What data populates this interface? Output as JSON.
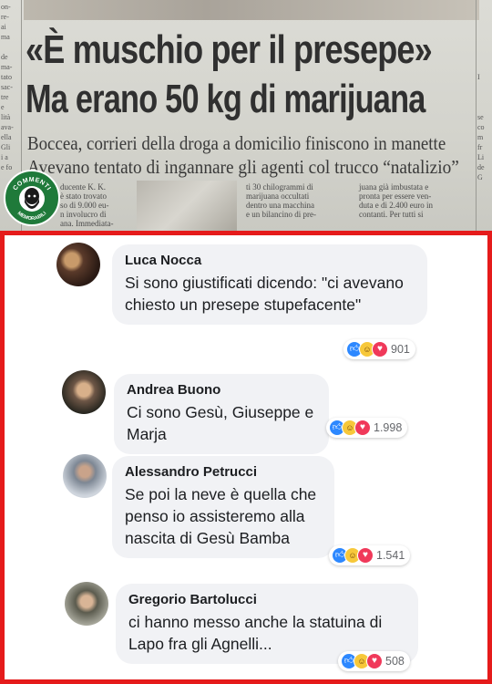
{
  "newspaper": {
    "headline_1": "«È muschio per il presepe»",
    "headline_2": "Ma erano 50 kg di marijuana",
    "subhead_1": "Boccea, corrieri della droga a domicilio finiscono in manette",
    "subhead_2": "Avevano tentato di ingannare gli agenti col trucco “natalizio”",
    "body_col_1": "ducente K. K.\nè stato trovato\nso di 9.000 eu-\nn involucro di\nana. Immediata-",
    "body_col_2": "ti 30 chilogrammi di\nmarijuana occultati\ndentro una macchina\ne un bilancino di pre-",
    "body_col_3": "juana già imbustata e\npronta per essere ven-\nduta e di 2.400 euro in\ncontanti. Per tutti si",
    "left_margin_text": "on-\nre-\nai\nma\n\nde\nma-\ntato\nsac-\ntre\ne\nlità\nava-\nella\nGli\ni a\ne fo",
    "right_margin_text": "\n\n\n\n\n\n\nI\n\n\n\nse\nco\nm\nfr\nLi\nde\nG"
  },
  "logo": {
    "text_top": "COMMENTI",
    "text_bottom": "MEMORABILI"
  },
  "comments": [
    {
      "author": "Luca Nocca",
      "text": "Si sono giustificati dicendo: \"ci avevano chiesto un presepe stupefacente\"",
      "reactions": [
        "like",
        "haha",
        "love"
      ],
      "count": "901"
    },
    {
      "author": "Andrea Buono",
      "text": "Ci sono Gesù, Giuseppe e Marja",
      "reactions": [
        "like",
        "haha",
        "love"
      ],
      "count": "1.998"
    },
    {
      "author": "Alessandro Petrucci",
      "text": "Se poi la neve è quella che penso io assisteremo alla nascita di Gesù Bamba",
      "reactions": [
        "like",
        "haha",
        "love"
      ],
      "count": "1.541"
    },
    {
      "author": "Gregorio Bartolucci",
      "text": "ci hanno messo anche la statuina di Lapo fra gli Agnelli...",
      "reactions": [
        "like",
        "haha",
        "love"
      ],
      "count": "508"
    }
  ],
  "colors": {
    "frame_border": "#e51b1b",
    "bubble_bg": "#f1f2f5",
    "like": "#2d88ff",
    "haha": "#f7c83a",
    "love": "#f0395a"
  }
}
